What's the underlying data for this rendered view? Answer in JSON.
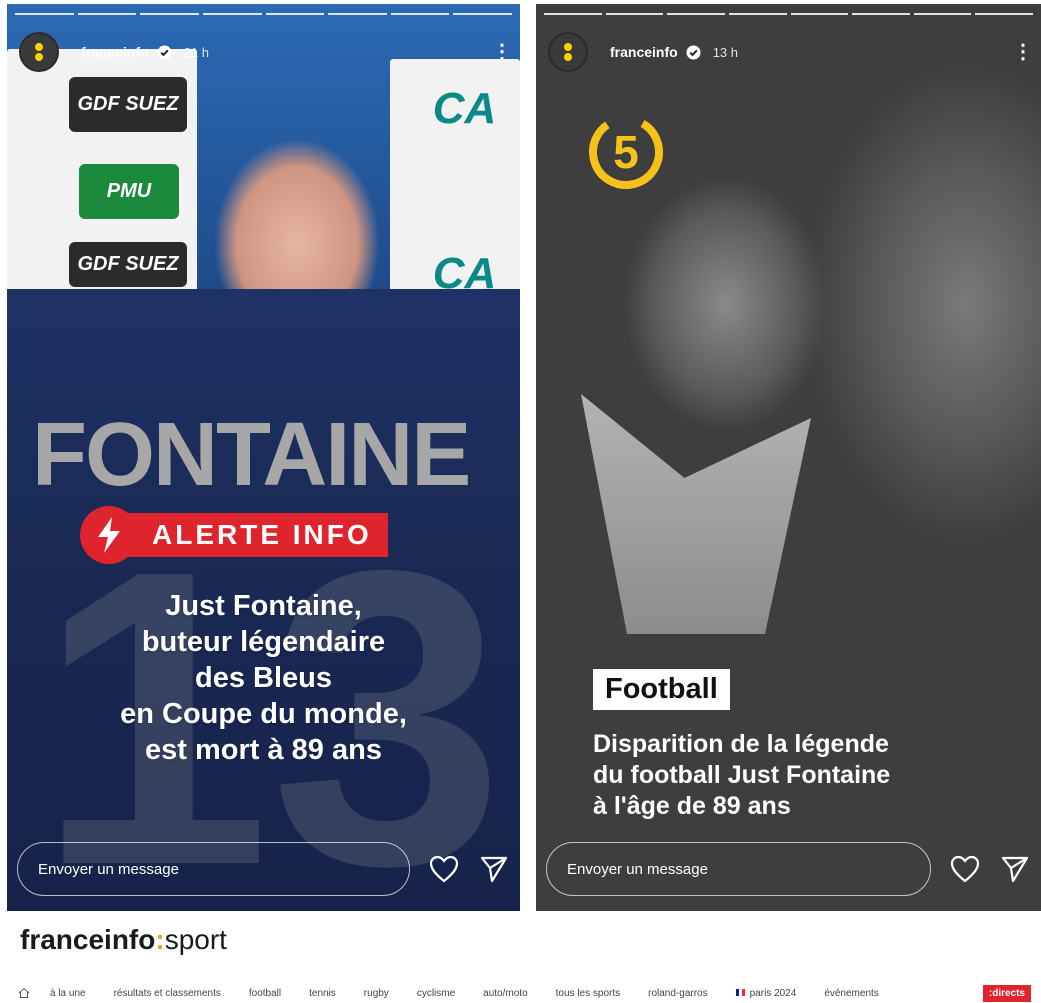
{
  "stories": [
    {
      "account": "franceinfo",
      "time": "21 h",
      "jersey_name": "FONTAINE",
      "jersey_number": "13",
      "sponsors": [
        "GDF SUEZ",
        "PMU",
        "GDF SUEZ",
        "CA",
        "CA"
      ],
      "alert_label": "ALERTE INFO",
      "headline_lines": [
        "Just Fontaine,",
        "buteur légendaire",
        "des Bleus",
        "en Coupe du monde,",
        "est mort à 89 ans"
      ],
      "message_placeholder": "Envoyer un message"
    },
    {
      "account": "franceinfo",
      "time": "13 h",
      "channel_number": "5",
      "tag": "Football",
      "headline_lines": [
        "Disparition de la légende",
        "du football Just Fontaine",
        "à l'âge de 89 ans"
      ],
      "message_placeholder": "Envoyer un message"
    }
  ],
  "site": {
    "logo_main": "franceinfo",
    "logo_sep": ":",
    "logo_sub": "sport",
    "nav": [
      "à la une",
      "résultats et classements",
      "football",
      "tennis",
      "rugby",
      "cyclisme",
      "auto/moto",
      "tous les sports",
      "roland-garros",
      "paris 2024",
      "événements"
    ],
    "directs": ":directs"
  },
  "colors": {
    "alert_red": "#e0242d",
    "brand_yellow": "#f6c11a"
  },
  "icons": [
    "verified-icon",
    "more-icon",
    "heart-icon",
    "send-icon",
    "lightning-icon",
    "home-icon",
    "france-flag-icon"
  ]
}
